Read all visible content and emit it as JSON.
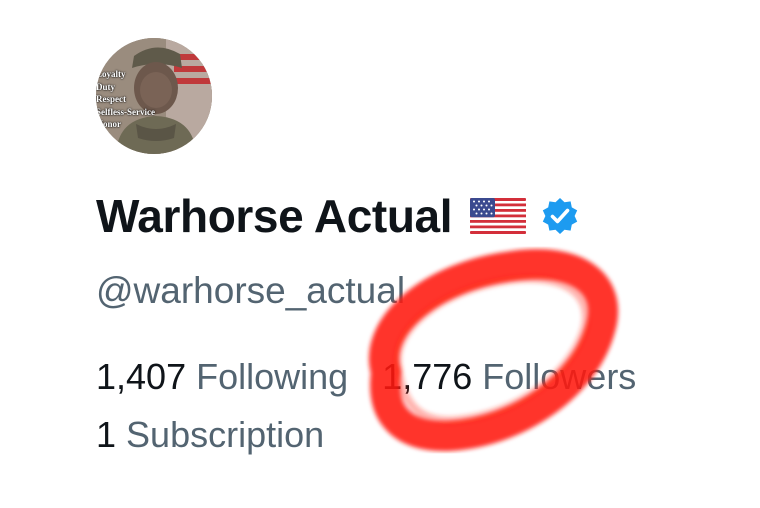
{
  "profile": {
    "avatar": {
      "alt": "Profile photo",
      "motto_lines": [
        "Loyalty",
        "Duty",
        "Respect",
        "Selfless-Service",
        "Honor"
      ]
    },
    "display_name": "Warhorse Actual",
    "flag_icon": "us-flag-emoji",
    "verified_icon": "verified-badge-icon",
    "verified_color": "#1d9bf0",
    "handle": "@warhorse_actual"
  },
  "stats": {
    "following_count": "1,407",
    "following_label": "Following",
    "followers_count": "1,776",
    "followers_label": "Followers",
    "subscriptions_count": "1",
    "subscriptions_label": "Subscription"
  },
  "annotation": {
    "type": "hand-drawn-circle",
    "color": "#ff1a10",
    "target": "followers"
  },
  "colors": {
    "primary_text": "#0f1419",
    "secondary_text": "#536471",
    "background": "#ffffff"
  }
}
